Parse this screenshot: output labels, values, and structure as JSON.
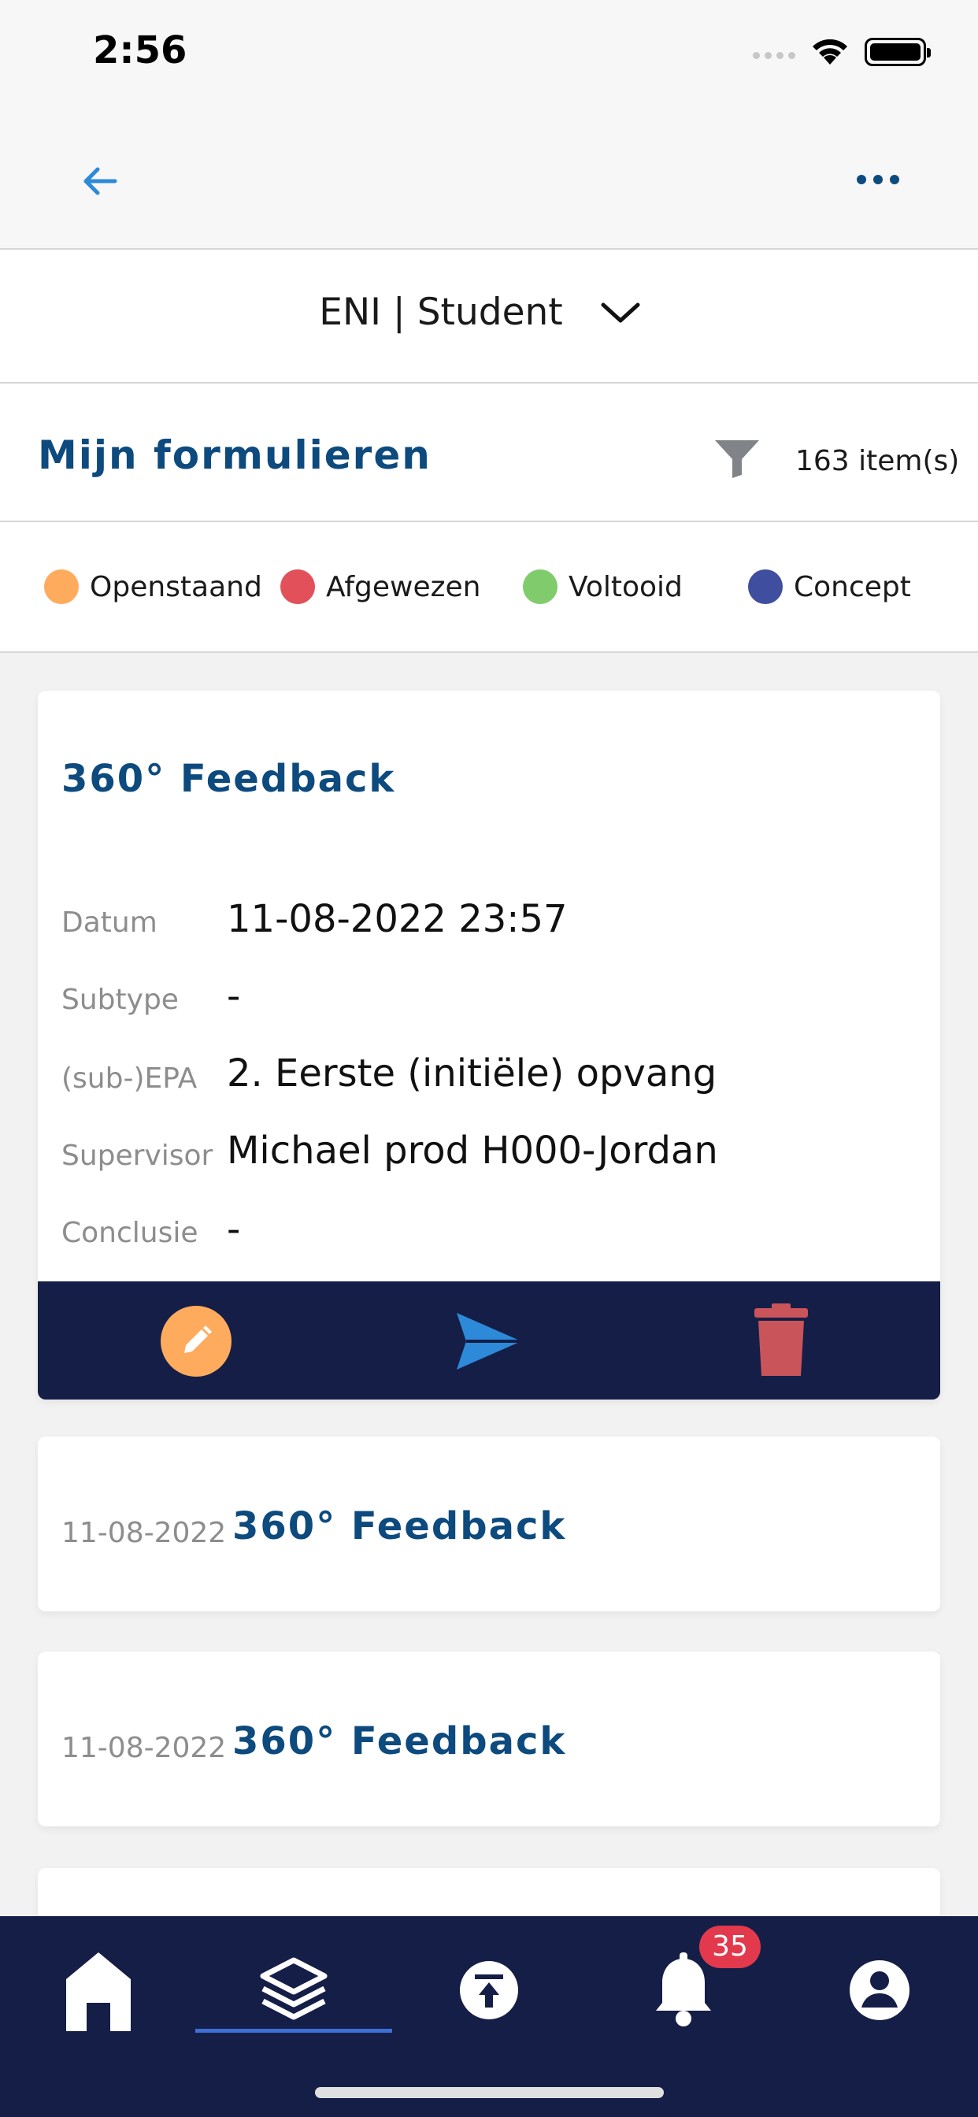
{
  "status_bar": {
    "time": "2:56"
  },
  "nav": {
    "back_icon": "arrow-left-icon",
    "more_icon": "ellipsis-icon"
  },
  "selector": {
    "label": "ENI | Student"
  },
  "header": {
    "title": "Mijn formulieren",
    "count": "163 item(s)"
  },
  "legend": [
    {
      "label": "Openstaand",
      "color": "#ffab5e"
    },
    {
      "label": "Afgewezen",
      "color": "#e2505a"
    },
    {
      "label": "Voltooid",
      "color": "#80cc6c"
    },
    {
      "label": "Concept",
      "color": "#3f4e9e"
    }
  ],
  "expanded_card": {
    "title": "360° Feedback",
    "rows": [
      {
        "label": "Datum",
        "value": "11-08-2022 23:57"
      },
      {
        "label": "Subtype",
        "value": "-"
      },
      {
        "label": "(sub-)EPA",
        "value": "2. Eerste (initiële) opvang"
      },
      {
        "label": "Supervisor",
        "value": "Michael prod H000-Jordan"
      },
      {
        "label": "Conclusie",
        "value": "-"
      }
    ]
  },
  "list": [
    {
      "date": "11-08-2022",
      "title": "360° Feedback"
    },
    {
      "date": "11-08-2022",
      "title": "360° Feedback"
    }
  ],
  "tabbar": {
    "notification_count": "35"
  }
}
